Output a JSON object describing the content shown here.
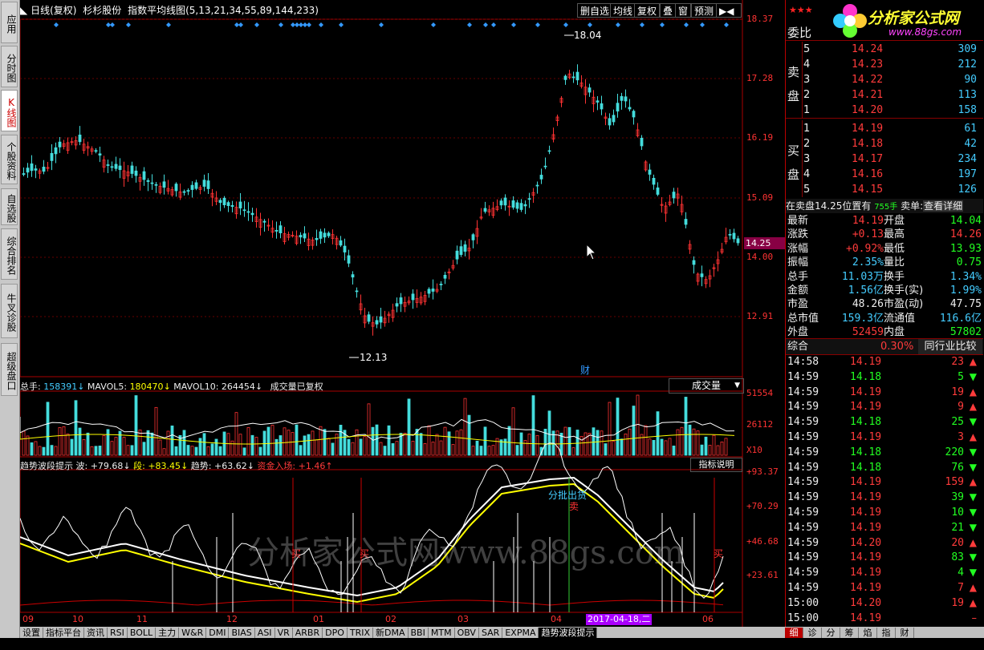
{
  "left_tabs": [
    {
      "label": "应用",
      "active": false
    },
    {
      "label": "分时图",
      "active": false
    },
    {
      "label": "K线图",
      "active": true
    },
    {
      "label": "个股资料",
      "active": false
    },
    {
      "label": "自选股",
      "active": false
    },
    {
      "label": "综合排名",
      "active": false
    },
    {
      "label": "牛叉诊股",
      "active": false
    },
    {
      "label": "超级盘口",
      "active": false
    }
  ],
  "header": {
    "period": "日线(复权)",
    "stock_name": "杉杉股份",
    "indicator": "指数平均线图(5,13,21,34,55,89,144,233)"
  },
  "toolbar": [
    "删自选",
    "均线",
    "复权",
    "叠",
    "窗",
    "预测"
  ],
  "logo": {
    "text": "分析家公式网",
    "url": "www.88gs.com"
  },
  "main_chart": {
    "y_labels": [
      "18.37",
      "17.28",
      "16.19",
      "15.09",
      "14.00",
      "12.91"
    ],
    "current_price": "14.25",
    "high_label": "18.04",
    "low_label": "12.13",
    "marker": "财",
    "cursor": "arrow-cursor-icon"
  },
  "volume_panel": {
    "title_prefix": "总手: ",
    "total": "158391",
    "mavol5_label": "MAVOL5: ",
    "mavol5": "180470",
    "mavol10_label": "MAVOL10: ",
    "mavol10": "264454",
    "note": "成交量已复权",
    "dropdown": "成交量",
    "y_labels": [
      "51554",
      "26112",
      "X10"
    ]
  },
  "trend_panel": {
    "title": "趋势波段提示",
    "wave_label": "波: ",
    "wave": "+79.68",
    "seg_label": "段: ",
    "seg": "+83.45",
    "trend_label": "趋势: ",
    "trend": "+63.62",
    "fund_label": "资金入场: ",
    "fund": "+1.46",
    "help": "指标说明",
    "y_labels": [
      "+93.37",
      "+70.29",
      "+46.68",
      "+23.61"
    ],
    "buy_text": "买",
    "sell_text": "卖",
    "batch_text": "分批出货"
  },
  "watermark": "分析家公式网www.88gs.com",
  "x_axis": {
    "labels": [
      "09",
      "10",
      "11",
      "12",
      "01",
      "02",
      "03",
      "04",
      "06"
    ],
    "date_highlight": "2017-04-18,二"
  },
  "bottom_tabs": [
    "设置",
    "指标平台",
    "资讯",
    "RSI",
    "BOLL",
    "主力",
    "W&R",
    "DMI",
    "BIAS",
    "ASI",
    "VR",
    "ARBR",
    "DPO",
    "TRIX",
    "新DMA",
    "BBI",
    "MTM",
    "OBV",
    "SAR",
    "EXPMA",
    "趋势波段提示"
  ],
  "order_book": {
    "header": "委比",
    "sell_label": "卖盘",
    "buy_label": "买盘",
    "sells": [
      {
        "lvl": "5",
        "price": "14.24",
        "vol": "309"
      },
      {
        "lvl": "4",
        "price": "14.23",
        "vol": "212"
      },
      {
        "lvl": "3",
        "price": "14.22",
        "vol": "90"
      },
      {
        "lvl": "2",
        "price": "14.21",
        "vol": "113"
      },
      {
        "lvl": "1",
        "price": "14.20",
        "vol": "158"
      }
    ],
    "buys": [
      {
        "lvl": "1",
        "price": "14.19",
        "vol": "61"
      },
      {
        "lvl": "2",
        "price": "14.18",
        "vol": "42"
      },
      {
        "lvl": "3",
        "price": "14.17",
        "vol": "234"
      },
      {
        "lvl": "4",
        "price": "14.16",
        "vol": "197"
      },
      {
        "lvl": "5",
        "price": "14.15",
        "vol": "126"
      }
    ]
  },
  "sell_info": {
    "text": "在卖盘14.25位置有",
    "hands": "755手",
    "sell_order": "卖单:",
    "details": "查看详细"
  },
  "quote": [
    {
      "l1": "最新",
      "v1": "14.19",
      "c1": "red",
      "l2": "开盘",
      "v2": "14.04",
      "c2": "grn"
    },
    {
      "l1": "涨跌",
      "v1": "+0.13",
      "c1": "red",
      "l2": "最高",
      "v2": "14.26",
      "c2": "red"
    },
    {
      "l1": "涨幅",
      "v1": "+0.92%",
      "c1": "red",
      "l2": "最低",
      "v2": "13.93",
      "c2": "grn"
    },
    {
      "l1": "振幅",
      "v1": "2.35%",
      "c1": "cyn",
      "l2": "量比",
      "v2": "0.75",
      "c2": "grn"
    },
    {
      "l1": "总手",
      "v1": "11.03万",
      "c1": "cyn",
      "l2": "换手",
      "v2": "1.34%",
      "c2": "cyn"
    },
    {
      "l1": "金额",
      "v1": "1.56亿",
      "c1": "cyn",
      "l2": "换手(实)",
      "v2": "1.99%",
      "c2": "cyn"
    },
    {
      "l1": "市盈",
      "v1": "48.26",
      "c1": "wht",
      "l2": "市盈(动)",
      "v2": "47.75",
      "c2": "wht"
    },
    {
      "l1": "总市值",
      "v1": "159.3亿",
      "c1": "cyn",
      "l2": "流通值",
      "v2": "116.6亿",
      "c2": "cyn"
    },
    {
      "l1": "外盘",
      "v1": "52459",
      "c1": "red",
      "l2": "内盘",
      "v2": "57802",
      "c2": "grn"
    }
  ],
  "composite": {
    "label": "综合",
    "pct": "0.30%",
    "compare": "同行业比较"
  },
  "ticks": [
    {
      "t": "14:58",
      "p": "14.19",
      "v": "23",
      "d": "up"
    },
    {
      "t": "14:59",
      "p": "14.18",
      "v": "5",
      "d": "down"
    },
    {
      "t": "14:59",
      "p": "14.19",
      "v": "19",
      "d": "up"
    },
    {
      "t": "14:59",
      "p": "14.19",
      "v": "9",
      "d": "up"
    },
    {
      "t": "14:59",
      "p": "14.18",
      "v": "25",
      "d": "down"
    },
    {
      "t": "14:59",
      "p": "14.19",
      "v": "3",
      "d": "up"
    },
    {
      "t": "14:59",
      "p": "14.18",
      "v": "220",
      "d": "down"
    },
    {
      "t": "14:59",
      "p": "14.18",
      "v": "76",
      "d": "down"
    },
    {
      "t": "14:59",
      "p": "14.19",
      "v": "159",
      "d": "up"
    },
    {
      "t": "14:59",
      "p": "14.19",
      "v": "39",
      "d": "down"
    },
    {
      "t": "14:59",
      "p": "14.19",
      "v": "10",
      "d": "down"
    },
    {
      "t": "14:59",
      "p": "14.19",
      "v": "21",
      "d": "down"
    },
    {
      "t": "14:59",
      "p": "14.20",
      "v": "20",
      "d": "up"
    },
    {
      "t": "14:59",
      "p": "14.19",
      "v": "83",
      "d": "down"
    },
    {
      "t": "14:59",
      "p": "14.19",
      "v": "4",
      "d": "down"
    },
    {
      "t": "14:59",
      "p": "14.19",
      "v": "7",
      "d": "up"
    },
    {
      "t": "15:00",
      "p": "14.20",
      "v": "19",
      "d": "up"
    },
    {
      "t": "15:00",
      "p": "14.19",
      "v": "",
      "d": "none"
    }
  ],
  "right_tabs": [
    "细",
    "诊",
    "分",
    "筹",
    "焰",
    "指",
    "财"
  ]
}
